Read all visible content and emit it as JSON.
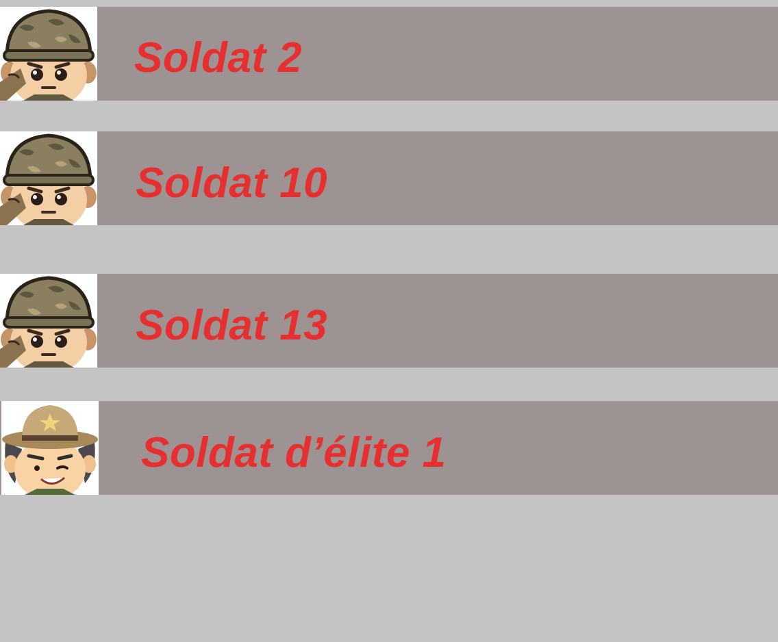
{
  "list": {
    "items": [
      {
        "label": "Soldat 2",
        "avatar_icon": "helmet-soldier-icon"
      },
      {
        "label": "Soldat 10",
        "avatar_icon": "helmet-soldier-icon"
      },
      {
        "label": "Soldat 13",
        "avatar_icon": "helmet-soldier-icon"
      },
      {
        "label": "Soldat d’élite 1",
        "avatar_icon": "ranger-hat-soldier-icon"
      }
    ]
  },
  "colors": {
    "background": "#c4c4c4",
    "row_background": "#9c9392",
    "label_text": "#e5302f"
  }
}
